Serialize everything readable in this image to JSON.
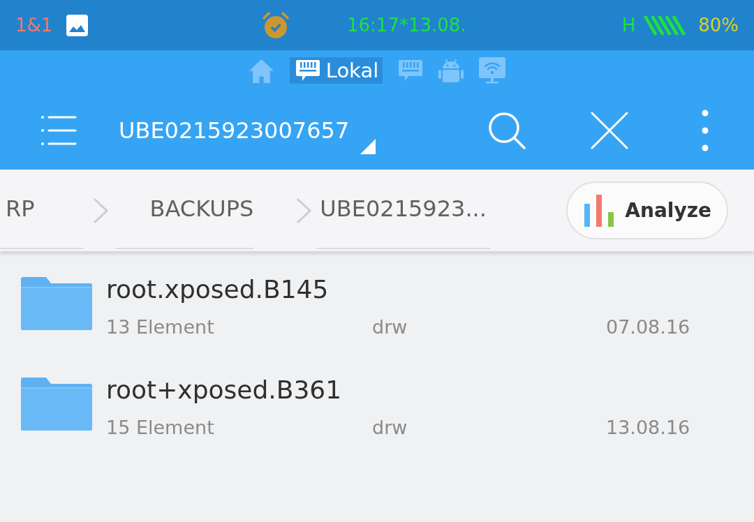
{
  "status_bar": {
    "carrier": "1&1",
    "time": "16:17*13.08.",
    "network_type": "H",
    "battery": "80%"
  },
  "location_tabs": [
    {
      "kind": "home",
      "selected": false
    },
    {
      "kind": "sd",
      "label": "Lokal",
      "selected": true
    },
    {
      "kind": "sd",
      "selected": false
    },
    {
      "kind": "android",
      "selected": false
    },
    {
      "kind": "wifi",
      "selected": false
    }
  ],
  "toolbar": {
    "title": "UBE0215923007657"
  },
  "breadcrumbs": [
    "RP",
    "BACKUPS",
    "UBE0215923..."
  ],
  "analyze_button": "Analyze",
  "files": [
    {
      "name": "root.xposed.B145",
      "item_count": "13 Element",
      "permissions": "drw",
      "date": "07.08.16"
    },
    {
      "name": "root+xposed.B361",
      "item_count": "15 Element",
      "permissions": "drw",
      "date": "13.08.16"
    }
  ]
}
